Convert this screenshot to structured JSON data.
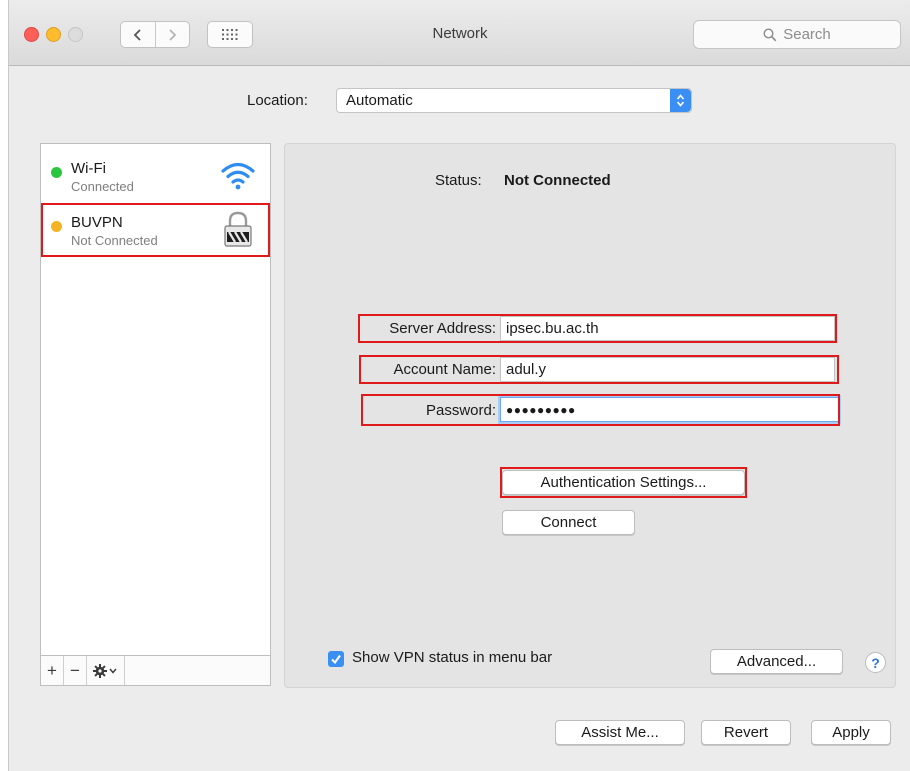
{
  "window": {
    "title": "Network"
  },
  "search": {
    "placeholder": "Search"
  },
  "location": {
    "label": "Location:",
    "value": "Automatic"
  },
  "services": [
    {
      "name": "Wi-Fi",
      "status": "Connected",
      "dot_color": "#2ac640",
      "icon": "wifi-icon"
    },
    {
      "name": "BUVPN",
      "status": "Not Connected",
      "dot_color": "#f5b323",
      "icon": "vpn-lock-icon"
    }
  ],
  "sidebar_tools": {
    "add": "+",
    "remove": "−"
  },
  "detail": {
    "status_label": "Status:",
    "status_value": "Not Connected",
    "server_address_label": "Server Address:",
    "server_address_value": "ipsec.bu.ac.th",
    "account_name_label": "Account Name:",
    "account_name_value": "adul.y",
    "password_label": "Password:",
    "password_value": "●●●●●●●●●",
    "auth_button": "Authentication Settings...",
    "connect_button": "Connect",
    "show_vpn_label": "Show VPN status in menu bar",
    "show_vpn_checked": true,
    "advanced_button": "Advanced...",
    "help_button": "?"
  },
  "footer": {
    "assist_button": "Assist Me...",
    "revert_button": "Revert",
    "apply_button": "Apply"
  },
  "colors": {
    "highlight": "#e0191b",
    "accent": "#3a8ff5"
  }
}
